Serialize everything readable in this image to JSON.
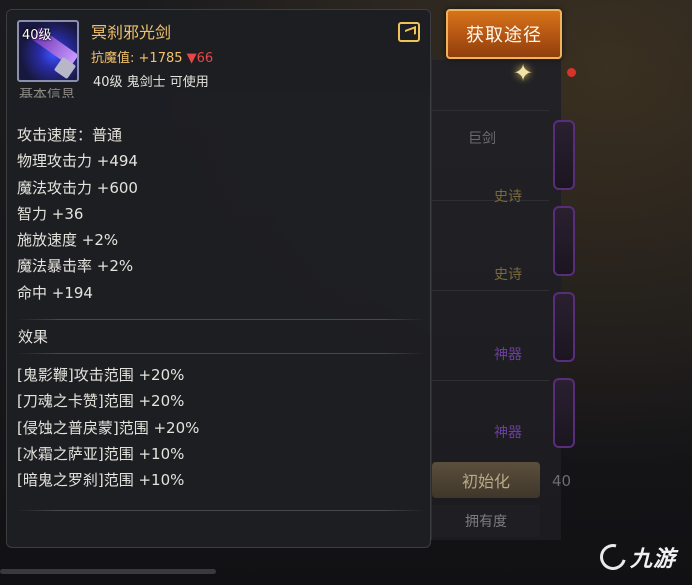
{
  "obtain_button": "获取途径",
  "item": {
    "level_tag": "40级",
    "name": "冥刹邪光剑",
    "resist_label": "抗魔值:",
    "resist_value": "+1785",
    "resist_delta": "▼66",
    "requirement": "40级 鬼剑士 可使用"
  },
  "section_partial": "基本信息",
  "stats": [
    "攻击速度：普通",
    "物理攻击力 +494",
    "魔法攻击力 +600",
    "智力 +36",
    "施放速度 +2%",
    "魔法暴击率 +2%",
    "命中 +194"
  ],
  "effect_title": "效果",
  "effects": [
    "[鬼影鞭]攻击范围 +20%",
    "[刀魂之卡赞]范围 +20%",
    "[侵蚀之普戾蒙]范围 +20%",
    "[冰霜之萨亚]范围 +10%",
    "[暗鬼之罗刹]范围 +10%"
  ],
  "background": {
    "tab_label": "巨剑",
    "rarity_1": "史诗",
    "rarity_2": "史诗",
    "rarity_3": "神器",
    "rarity_4": "神器",
    "init_button": "初始化",
    "own_label": "拥有度",
    "count": "40"
  },
  "watermark": "九游",
  "colors": {
    "item_name": "#f2c26b",
    "resist_delta": "#e54848",
    "obtain_button": "#c8631a"
  }
}
